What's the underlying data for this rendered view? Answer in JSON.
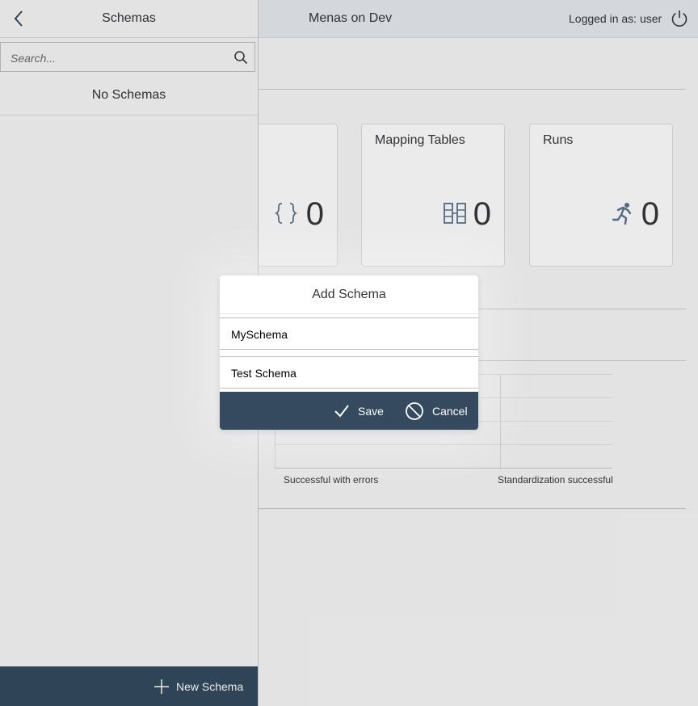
{
  "header": {
    "app_title": "Menas on Dev",
    "logged_in_label": "Logged in as: user"
  },
  "tiles": [
    {
      "title": "",
      "count": "0",
      "icon": "curly-braces-icon"
    },
    {
      "title": "Mapping Tables",
      "count": "0",
      "icon": "mapping-table-icon"
    },
    {
      "title": "Runs",
      "count": "0",
      "icon": "running-person-icon"
    }
  ],
  "chart": {
    "categories": [
      "Successful with errors",
      "Standardization successful"
    ]
  },
  "sidebar": {
    "title": "Schemas",
    "search_placeholder": "Search...",
    "empty_text": "No Schemas",
    "new_button_label": "New Schema"
  },
  "dialog": {
    "title": "Add Schema",
    "name_value": "MySchema",
    "description_value": "Test Schema",
    "save_label": "Save",
    "cancel_label": "Cancel"
  },
  "colors": {
    "shell_dark": "#354a5f",
    "accent": "#0a6ed1",
    "icon_blue": "#5b738b"
  }
}
